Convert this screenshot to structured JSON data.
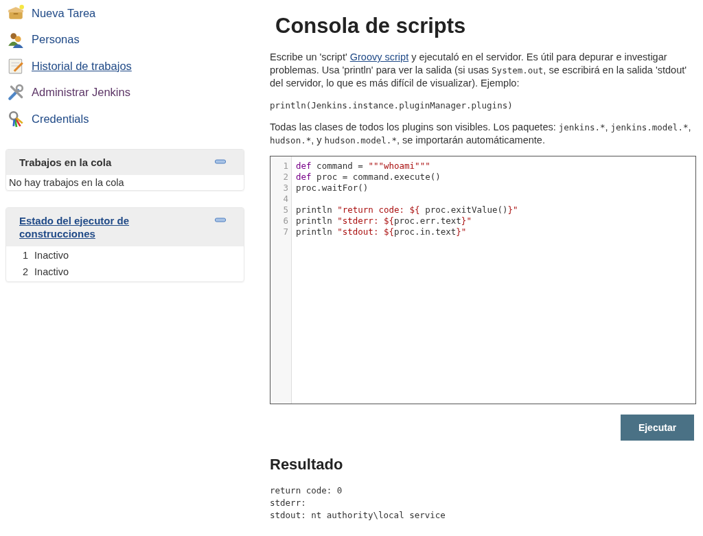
{
  "sidebar": {
    "tasks": [
      {
        "label": "Nueva Tarea",
        "kind": "box",
        "hovered": false,
        "visited": false
      },
      {
        "label": "Personas",
        "kind": "people",
        "hovered": false,
        "visited": false
      },
      {
        "label": "Historial de trabajos",
        "kind": "notepad",
        "hovered": true,
        "visited": false
      },
      {
        "label": "Administrar Jenkins",
        "kind": "tools",
        "hovered": false,
        "visited": true
      },
      {
        "label": "Credentials",
        "kind": "keys",
        "hovered": false,
        "visited": false
      }
    ],
    "panels": [
      {
        "title": "Trabajos en la cola",
        "title_link": false,
        "expanded": true,
        "rows": [
          {
            "text": "No hay trabajos en la cola"
          }
        ]
      },
      {
        "title": "Estado del ejecutor de construcciones",
        "title_link": true,
        "expanded": true,
        "rows": [
          {
            "number": "1",
            "text": "Inactivo"
          },
          {
            "number": "2",
            "text": "Inactivo"
          }
        ]
      }
    ]
  },
  "main": {
    "title": "Consola de scripts",
    "intro": [
      [
        {
          "kind": "text",
          "text": "Escribe un 'script' "
        },
        {
          "kind": "link",
          "text": "Groovy script"
        },
        {
          "kind": "text",
          "text": " y ejecutaló en el servidor. Es útil para depurar e investigar problemas. Usa 'println' para ver la salida (si usas "
        },
        {
          "kind": "code",
          "text": "System.out"
        },
        {
          "kind": "text",
          "text": ", se escribirá en la salida 'stdout' del servidor, lo que es más difícil de visualizar). Ejemplo:"
        }
      ],
      [
        {
          "kind": "code",
          "text": "println(Jenkins.instance.pluginManager.plugins)"
        }
      ],
      [
        {
          "kind": "text",
          "text": "Todas las clases de todos los plugins son visibles. Los paquetes: "
        },
        {
          "kind": "code",
          "text": "jenkins.*"
        },
        {
          "kind": "text",
          "text": ", "
        },
        {
          "kind": "code",
          "text": "jenkins.model.*"
        },
        {
          "kind": "text",
          "text": ", "
        },
        {
          "kind": "code",
          "text": "hudson.*"
        },
        {
          "kind": "text",
          "text": ", y "
        },
        {
          "kind": "code",
          "text": "hudson.model.*"
        },
        {
          "kind": "text",
          "text": ", se importarán automáticamente."
        }
      ]
    ],
    "editor": {
      "lines": [
        {
          "number": "1",
          "tokens": [
            {
              "kind": "keyword",
              "text": "def"
            },
            {
              "kind": "plain",
              "text": " command = "
            },
            {
              "kind": "string",
              "text": "\"\"\"whoami\"\"\""
            }
          ]
        },
        {
          "number": "2",
          "tokens": [
            {
              "kind": "keyword",
              "text": "def"
            },
            {
              "kind": "plain",
              "text": " proc = command.execute()"
            }
          ]
        },
        {
          "number": "3",
          "tokens": [
            {
              "kind": "plain",
              "text": "proc.waitFor()"
            }
          ]
        },
        {
          "number": "4"
        },
        {
          "number": "5",
          "tokens": [
            {
              "kind": "plain",
              "text": "println "
            },
            {
              "kind": "string",
              "text": "\"return code: ${"
            },
            {
              "kind": "plain",
              "text": " proc.exitValue()"
            },
            {
              "kind": "string",
              "text": "}\""
            }
          ]
        },
        {
          "number": "6",
          "tokens": [
            {
              "kind": "plain",
              "text": "println "
            },
            {
              "kind": "string",
              "text": "\"stderr: ${"
            },
            {
              "kind": "plain",
              "text": "proc.err.text"
            },
            {
              "kind": "string",
              "text": "}\""
            }
          ]
        },
        {
          "number": "7",
          "tokens": [
            {
              "kind": "plain",
              "text": "println "
            },
            {
              "kind": "string",
              "text": "\"stdout: ${"
            },
            {
              "kind": "plain",
              "text": "proc.in.text"
            },
            {
              "kind": "string",
              "text": "}\""
            }
          ]
        }
      ]
    },
    "run_button": "Ejecutar",
    "result_title": "Resultado",
    "result_lines": [
      "return code: 0",
      "stderr:",
      "stdout: nt authority\\local service"
    ]
  }
}
